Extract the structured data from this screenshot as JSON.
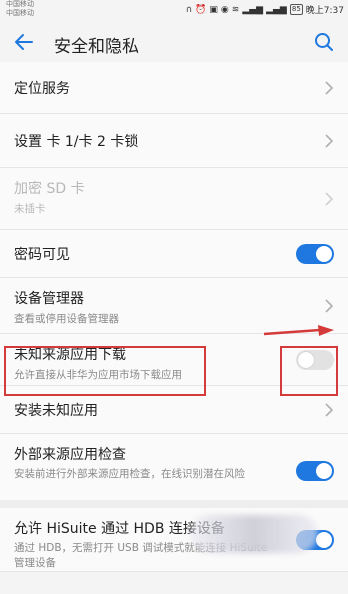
{
  "status_bar": {
    "carrier1": "中国移动",
    "carrier2": "中国移动",
    "battery": "85",
    "time": "晚上7:37"
  },
  "header": {
    "title": "安全和隐私"
  },
  "rows": [
    {
      "label": "定位服务",
      "type": "chevron"
    },
    {
      "label": "设置 卡 1/卡 2 卡锁",
      "type": "chevron"
    },
    {
      "label": "加密 SD 卡",
      "sub": "未插卡",
      "type": "chevron",
      "disabled": true
    },
    {
      "label": "密码可见",
      "type": "toggle",
      "on": true
    },
    {
      "label": "设备管理器",
      "sub": "查看或停用设备管理器",
      "type": "chevron"
    },
    {
      "label": "未知来源应用下载",
      "sub": "允许直接从非华为应用市场下载应用",
      "type": "toggle",
      "on": false
    },
    {
      "label": "安装未知应用",
      "type": "chevron"
    },
    {
      "label": "外部来源应用检查",
      "sub": "安装前进行外部来源应用检查，在线识别潜在风险",
      "type": "toggle",
      "on": true
    },
    {
      "label": "允许 HiSuite 通过 HDB 连接设备",
      "sub": "通过 HDB，无需打开 USB 调试模式就能连接 HiSuite 管理设备",
      "type": "toggle",
      "on": true
    }
  ],
  "colors": {
    "accent": "#1e78e0",
    "highlight": "#d43a3a"
  }
}
